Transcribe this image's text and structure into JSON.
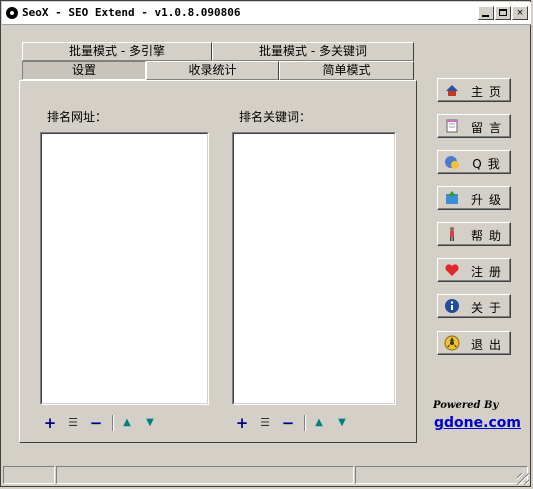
{
  "window": {
    "title": "SeoX - SEO Extend - v1.0.8.090806"
  },
  "title_buttons": {
    "minimize": "",
    "maximize": "",
    "close": "×"
  },
  "tabs_row_back": [
    {
      "label": "批量模式 - 多引擎"
    },
    {
      "label": "批量模式 - 多关键词"
    }
  ],
  "tabs_row_front": [
    {
      "label": "设置",
      "active": true
    },
    {
      "label": "收录统计",
      "active": false
    },
    {
      "label": "简单模式",
      "active": false
    }
  ],
  "panel": {
    "url_label": "排名网址：",
    "keyword_label": "排名关键词：",
    "tools": {
      "add": "+",
      "list": "☰",
      "remove": "−",
      "up": "▲",
      "down": "▼"
    }
  },
  "sidebar": [
    {
      "label": "主页",
      "icon": "home-icon"
    },
    {
      "label": "留言",
      "icon": "notepad-icon"
    },
    {
      "label": "Q我",
      "icon": "qq-chat-icon"
    },
    {
      "label": "升级",
      "icon": "upgrade-icon"
    },
    {
      "label": "帮助",
      "icon": "help-figure-icon"
    },
    {
      "label": "注册",
      "icon": "heart-icon"
    },
    {
      "label": "关于",
      "icon": "info-icon"
    },
    {
      "label": "退出",
      "icon": "exit-icon"
    }
  ],
  "footer": {
    "powered_by": "Powered By",
    "site": "gdone.com"
  },
  "colors": {
    "window_bg": "#d4d0c8",
    "link": "#0000cc",
    "tool_blue": "#00008b",
    "tool_teal": "#008080"
  }
}
